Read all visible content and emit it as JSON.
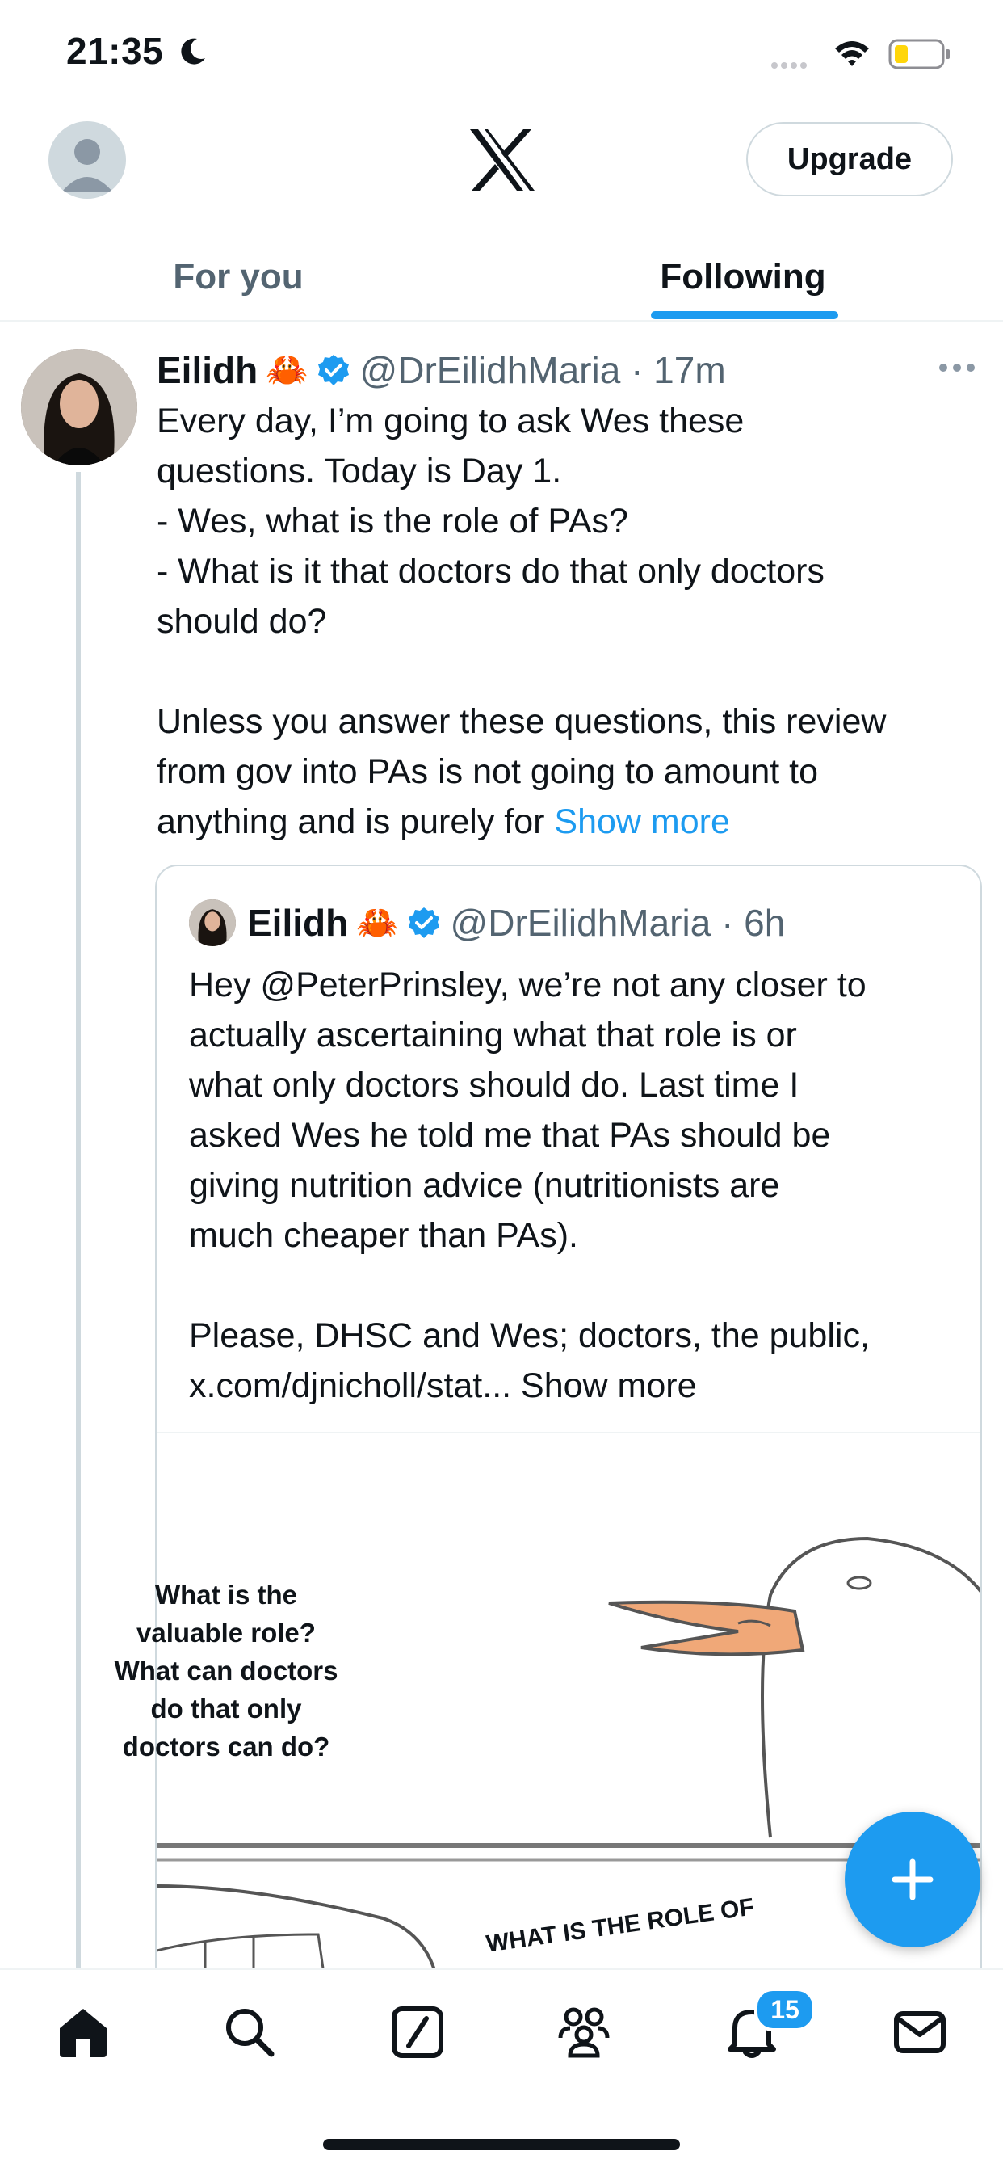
{
  "status_bar": {
    "time": "21:35"
  },
  "header": {
    "upgrade_label": "Upgrade",
    "tabs": [
      {
        "label": "For you",
        "active": false
      },
      {
        "label": "Following",
        "active": true
      }
    ]
  },
  "tweet": {
    "author_name": "Eilidh",
    "author_emoji": "🦀",
    "handle_time": "@DrEilidhMaria · 17m",
    "body": "Every day, I’m going to ask Wes these\nquestions. Today is Day 1.\n- Wes, what is the role of PAs?\n- What is it that doctors do that only doctors\nshould do?\n\nUnless you answer these questions, this review\nfrom gov into PAs is not going to amount to\nanything and is purely for ",
    "show_more": "Show more",
    "quote": {
      "author_name": "Eilidh",
      "author_emoji": "🦀",
      "handle_time": "@DrEilidhMaria · 6h",
      "body": "Hey @PeterPrinsley, we’re not any closer to\nactually ascertaining what that role is or\nwhat only doctors should do. Last time I\nasked Wes he told me that PAs should be\ngiving nutrition advice (nutritionists are\nmuch cheaper than PAs).\n\nPlease, DHSC and Wes; doctors, the public,\nx.com/djnicholl/stat... Show more",
      "media_text": "What is the valuable role? What can doctors do that only doctors can do?",
      "media_text_2": "WHAT IS THE ROLE OF"
    }
  },
  "bottom_nav": {
    "notification_count": "15"
  },
  "colors": {
    "accent": "#1d9bf0",
    "text": "#0f1419",
    "secondary": "#536471",
    "border": "#cfd9de"
  }
}
